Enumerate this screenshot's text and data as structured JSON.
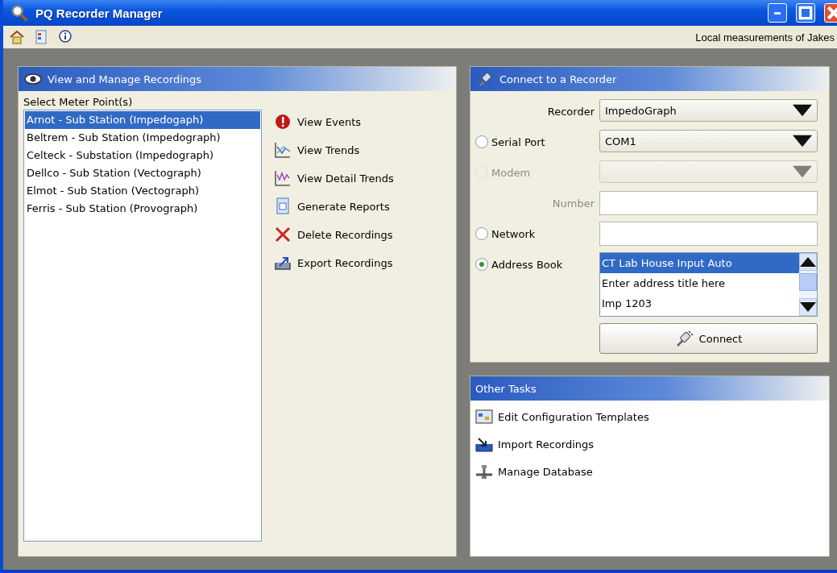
{
  "window": {
    "title": "PQ Recorder Manager"
  },
  "toolbar": {
    "description": "Local measurements of Jakes"
  },
  "recordings_panel": {
    "title": "View and Manage Recordings",
    "list_label": "Select Meter Point(s)",
    "meter_points": [
      {
        "label": "Arnot - Sub Station (Impedogaph)",
        "selected": true
      },
      {
        "label": "Beltrem - Sub Station (Impedograph)",
        "selected": false
      },
      {
        "label": "Celteck - Substation (Impedograph)",
        "selected": false
      },
      {
        "label": "Dellco - Sub Station (Vectograph)",
        "selected": false
      },
      {
        "label": "Elmot - Sub Station (Vectograph)",
        "selected": false
      },
      {
        "label": "Ferris - Sub Station (Provograph)",
        "selected": false
      }
    ],
    "actions": [
      {
        "label": "View Events",
        "kind": "events"
      },
      {
        "label": "View Trends",
        "kind": "trends"
      },
      {
        "label": "View Detail Trends",
        "kind": "detail"
      },
      {
        "label": "Generate Reports",
        "kind": "report"
      },
      {
        "label": "Delete Recordings",
        "kind": "delete"
      },
      {
        "label": "Export Recordings",
        "kind": "export"
      }
    ]
  },
  "connect_panel": {
    "title": "Connect to a Recorder",
    "rows": [
      {
        "kind": "select",
        "label": "Recorder",
        "value": "ImpedoGraph",
        "disabled": false
      },
      {
        "kind": "radio-select",
        "label": "Serial Port",
        "value": "COM1",
        "selected": false,
        "disabled": false
      },
      {
        "kind": "radio-select",
        "label": "Modem",
        "selected": false,
        "disabled": true
      },
      {
        "kind": "input",
        "label": "Number",
        "disabled": true
      },
      {
        "kind": "radio-input",
        "label": "Network",
        "selected": false,
        "disabled": false
      },
      {
        "kind": "radio-list",
        "label": "Address Book",
        "selected": true,
        "disabled": false,
        "items": [
          {
            "label": "CT Lab House Input Auto",
            "selected": true
          },
          {
            "label": "Enter address title here",
            "selected": false
          },
          {
            "label": "Imp 1203",
            "selected": false
          }
        ]
      }
    ],
    "button": "Connect"
  },
  "tasks_panel": {
    "title": "Other Tasks",
    "tasks": [
      {
        "label": "Edit Configuration Templates",
        "kind": "template"
      },
      {
        "label": "Import Recordings",
        "kind": "import"
      },
      {
        "label": "Manage Database",
        "kind": "database"
      }
    ]
  }
}
